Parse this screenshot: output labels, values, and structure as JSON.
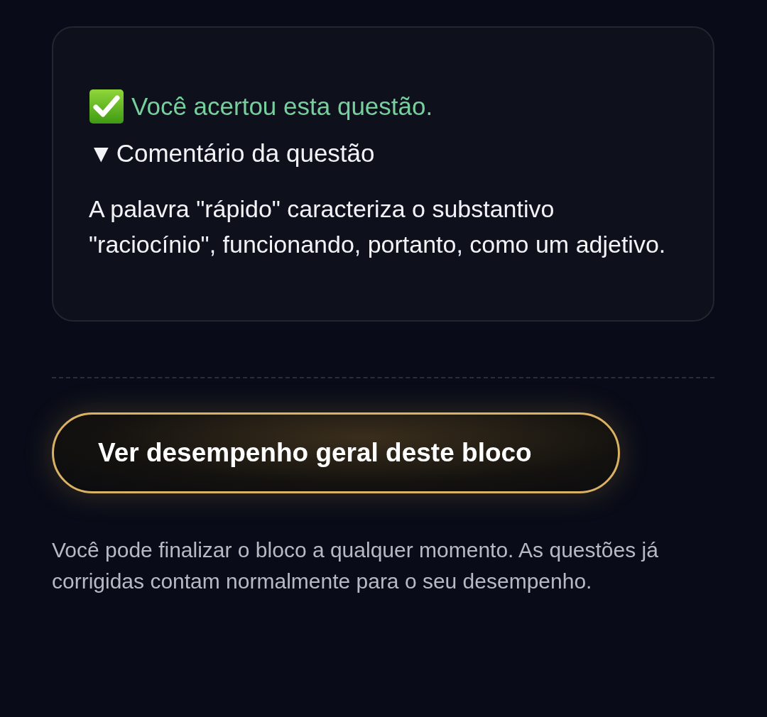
{
  "result": {
    "correct": true,
    "text": "Você acertou esta questão."
  },
  "comment": {
    "marker": "▼",
    "title": "Comentário da questão",
    "expanded": true,
    "body": "A palavra \"rápido\" caracteriza o substantivo \"raciocínio\", funcionando, portanto, como um adjetivo."
  },
  "button": {
    "label": "Ver desempenho geral deste bloco"
  },
  "note": "Você pode finalizar o bloco a qualquer momento. As questões já corrigidas contam normalmente para o seu desempenho."
}
